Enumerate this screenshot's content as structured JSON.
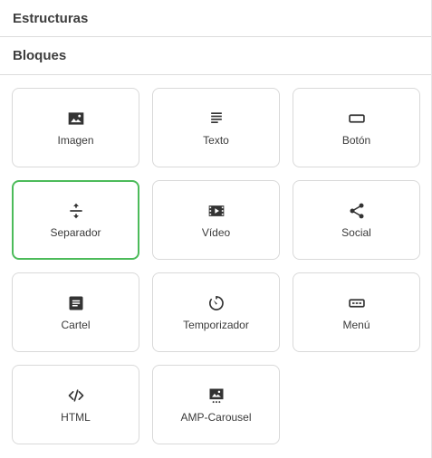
{
  "sections": {
    "structures_label": "Estructuras",
    "blocks_label": "Bloques"
  },
  "colors": {
    "selected_border": "#4cbb5a",
    "icon": "#333333"
  },
  "blocks": [
    {
      "label": "Imagen",
      "icon": "image-icon"
    },
    {
      "label": "Texto",
      "icon": "text-icon"
    },
    {
      "label": "Botón",
      "icon": "button-icon"
    },
    {
      "label": "Separador",
      "icon": "divider-icon",
      "selected": true
    },
    {
      "label": "Vídeo",
      "icon": "video-icon"
    },
    {
      "label": "Social",
      "icon": "share-icon"
    },
    {
      "label": "Cartel",
      "icon": "banner-icon"
    },
    {
      "label": "Temporizador",
      "icon": "timer-icon"
    },
    {
      "label": "Menú",
      "icon": "menu-icon"
    },
    {
      "label": "HTML",
      "icon": "code-icon"
    },
    {
      "label": "AMP-Carousel",
      "icon": "carousel-icon"
    }
  ]
}
